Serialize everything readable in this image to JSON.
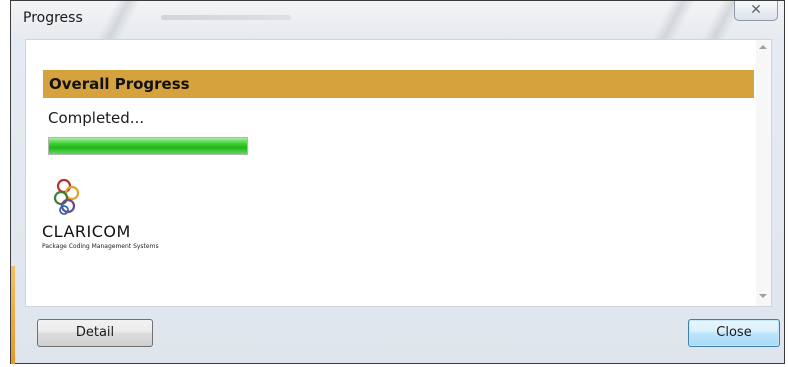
{
  "window": {
    "title": "Progress",
    "close_glyph": "✕"
  },
  "progress": {
    "section_title": "Overall Progress",
    "status_text": "Completed...",
    "value_percent": 100
  },
  "logo": {
    "name": "CLARICOM",
    "tagline": "Package Coding Management Systems"
  },
  "buttons": {
    "detail_label": "Detail",
    "close_label": "Close"
  },
  "colors": {
    "header_bar": "#d5a23e",
    "progress_green": "#1fb51a",
    "close_button_border": "#3c7fb1"
  },
  "icons": {
    "logo_mark": "claricom-rings-icon",
    "window_close": "close-icon"
  }
}
